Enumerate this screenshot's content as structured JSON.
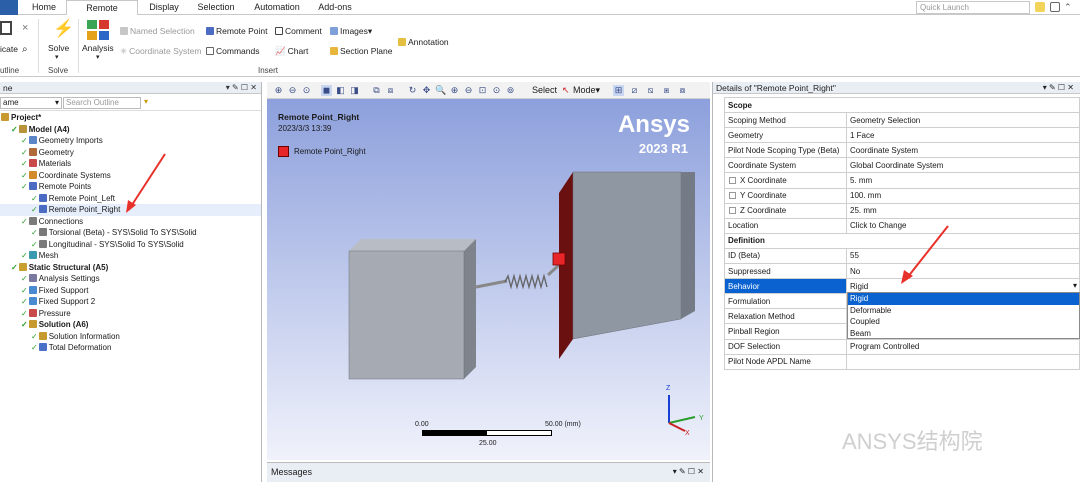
{
  "ribbon": {
    "tabs": [
      "Home",
      "Remote Points",
      "Display",
      "Selection",
      "Automation",
      "Add-ons"
    ],
    "active_tab": "Remote Points",
    "quick_launch_placeholder": "Quick Launch",
    "duplicate_label": "icate",
    "outline_label": "utline",
    "solve_label": "Solve",
    "solve_group": "Solve",
    "analysis_label": "Analysis",
    "named_selection": "Named Selection",
    "coordinate_system": "Coordinate System",
    "remote_point": "Remote Point",
    "commands": "Commands",
    "comment": "Comment",
    "chart": "Chart",
    "images": "Images",
    "section_plane": "Section Plane",
    "annotation": "Annotation",
    "insert_group": "Insert"
  },
  "outline": {
    "title": "ne",
    "name_select": "ame",
    "search_placeholder": "Search Outline",
    "tree": [
      {
        "label": "Project*",
        "level": 0,
        "bold": true
      },
      {
        "label": "Model (A4)",
        "level": 1,
        "bold": true
      },
      {
        "label": "Geometry Imports",
        "level": 2
      },
      {
        "label": "Geometry",
        "level": 2
      },
      {
        "label": "Materials",
        "level": 2
      },
      {
        "label": "Coordinate Systems",
        "level": 2
      },
      {
        "label": "Remote Points",
        "level": 2
      },
      {
        "label": "Remote Point_Left",
        "level": 3
      },
      {
        "label": "Remote Point_Right",
        "level": 3,
        "selected": true
      },
      {
        "label": "Connections",
        "level": 2
      },
      {
        "label": "Torsional (Beta) - SYS\\Solid To SYS\\Solid",
        "level": 3
      },
      {
        "label": "Longitudinal - SYS\\Solid To SYS\\Solid",
        "level": 3
      },
      {
        "label": "Mesh",
        "level": 2
      },
      {
        "label": "Static Structural (A5)",
        "level": 1,
        "bold": true
      },
      {
        "label": "Analysis Settings",
        "level": 2
      },
      {
        "label": "Fixed Support",
        "level": 2
      },
      {
        "label": "Fixed Support 2",
        "level": 2
      },
      {
        "label": "Pressure",
        "level": 2
      },
      {
        "label": "Solution (A6)",
        "level": 2,
        "bold": true
      },
      {
        "label": "Solution Information",
        "level": 3
      },
      {
        "label": "Total Deformation",
        "level": 3
      }
    ]
  },
  "viewport": {
    "title": "Remote Point_Right",
    "timestamp": "2023/3/3 13:39",
    "legend": "Remote Point_Right",
    "brand": "Ansys",
    "version": "2023 R1",
    "select_label": "Select",
    "mode_label": "Mode",
    "scale": {
      "start": "0.00",
      "end": "50.00 (mm)",
      "mid": "25.00"
    },
    "axes": {
      "x": "X",
      "y": "Y",
      "z": "Z"
    },
    "messages_label": "Messages"
  },
  "details": {
    "title": "Details of \"Remote Point_Right\"",
    "sections": [
      {
        "name": "Scope",
        "rows": [
          [
            "Scoping Method",
            "Geometry Selection"
          ],
          [
            "Geometry",
            "1 Face"
          ],
          [
            "Pilot Node Scoping Type (Beta)",
            "Coordinate System"
          ],
          [
            "Coordinate System",
            "Global Coordinate System"
          ],
          [
            "X Coordinate",
            "5. mm"
          ],
          [
            "Y Coordinate",
            "100. mm"
          ],
          [
            "Z Coordinate",
            "25. mm"
          ],
          [
            "Location",
            "Click to Change"
          ]
        ]
      },
      {
        "name": "Definition",
        "rows": [
          [
            "ID (Beta)",
            "55"
          ],
          [
            "Suppressed",
            "No"
          ],
          [
            "Behavior",
            "Rigid"
          ],
          [
            "Formulation",
            ""
          ],
          [
            "Relaxation Method",
            ""
          ],
          [
            "Pinball Region",
            ""
          ],
          [
            "DOF Selection",
            "Program Controlled"
          ],
          [
            "Pilot Node APDL Name",
            ""
          ]
        ]
      }
    ],
    "behavior_options": [
      "Rigid",
      "Deformable",
      "Coupled",
      "Beam"
    ],
    "behavior_selected": "Rigid"
  },
  "watermark": "ANSYS结构院",
  "colors": {
    "accent": "#0a62d0",
    "annotation_arrow": "#e8312a",
    "viewport_top": "#8da0dc"
  }
}
